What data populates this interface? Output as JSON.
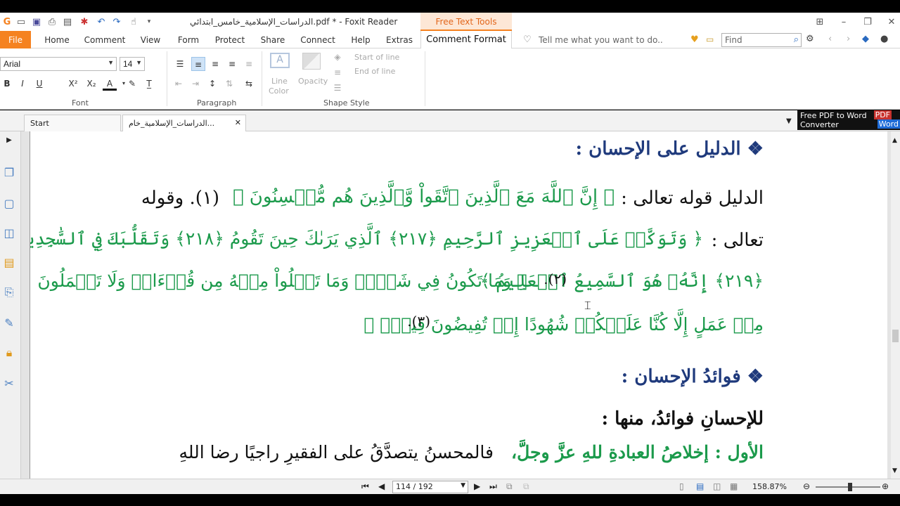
{
  "titlebar": {
    "title": "الدراسات_الإسلامية_خامس_ابتدائي.pdf * - Foxit Reader",
    "context_tab": "Free Text Tools"
  },
  "tabs": [
    "Home",
    "Comment",
    "View",
    "Form",
    "Protect",
    "Share",
    "Connect",
    "Help",
    "Extras"
  ],
  "file_tab": "File",
  "active_tab": "Comment Format",
  "tell_me": "Tell me what you want to do..",
  "find_placeholder": "Find",
  "font": {
    "name": "Arial",
    "size": "14",
    "group_label": "Font"
  },
  "paragraph_label": "Paragraph",
  "shape_style": {
    "line_color": "Line\nColor",
    "line_color_1": "Line",
    "line_color_2": "Color",
    "opacity": "Opacity",
    "start_of_line": "Start of line",
    "end_of_line": "End of line",
    "group_label": "Shape Style"
  },
  "doc_tabs": {
    "start": "Start",
    "file": "الدراسات_الإسلامية_خام..."
  },
  "promo": {
    "line1": "Free PDF to Word",
    "line2": "Converter",
    "badge1": "PDF",
    "badge2": "Word"
  },
  "page": {
    "heading1": "❖ الدليل على الإحسان :",
    "line1_pre": "الدليل قوله تعالى :",
    "line1_quran": "﴿ إِنَّ ٱللَّهَ مَعَ ٱلَّذِينَ ٱتَّقَواْ وَّٱلَّذِينَ هُم مُّحۡسِنُونَ ﴾",
    "line1_post": "(١). وقوله",
    "line2_pre": "تعالى :",
    "line2_quran": "﴿ وَتَوَكَّلۡ عَلَى ٱلۡعَزِيزِ ٱلرَّحِيمِ ﴿٢١٧﴾ ٱلَّذِي يَرَىٰكَ حِينَ تَقُومُ ﴿٢١٨﴾ وَتَقَلُّبَكَ فِي ٱلسَّٰجِدِينَ",
    "line3_quran_a": "﴿٢١٩﴾ إِنَّهُۥ هُوَ ٱلسَّمِيعُ ٱلۡعَلِيمُ ﴾",
    "line3_note": "(٢).",
    "line3_quran_b": "﴿ وَمَا تَكُونُ فِي شَأۡنٖ وَمَا تَتۡلُواْ مِنۡهُ مِن قُرۡءَانٖ وَلَا تَعۡمَلُونَ",
    "line4_quran": "مِنۡ عَمَلٍ إِلَّا كُنَّا عَلَيۡكُمۡ شُهُودًا إِذۡ تُفِيضُونَ فِيهِۚ ﴾",
    "line4_note": "(٣).",
    "heading2": "❖ فوائدُ الإحسان :",
    "line5": "للإحسانِ فوائدُ، منها :",
    "line6_green": "الأول : إخلاصُ العبادةِ للهِ عزَّ وجلَّ،",
    "line6_black": "فالمحسنُ يتصدَّقُ على الفقيرِ راجيًا رضا اللهِ"
  },
  "status": {
    "page_indicator": "114 / 192",
    "zoom": "158.87%"
  },
  "colors": {
    "accent": "#f58220",
    "heading_blue": "#1f3a7c",
    "quran_green": "#1b9a4b"
  }
}
